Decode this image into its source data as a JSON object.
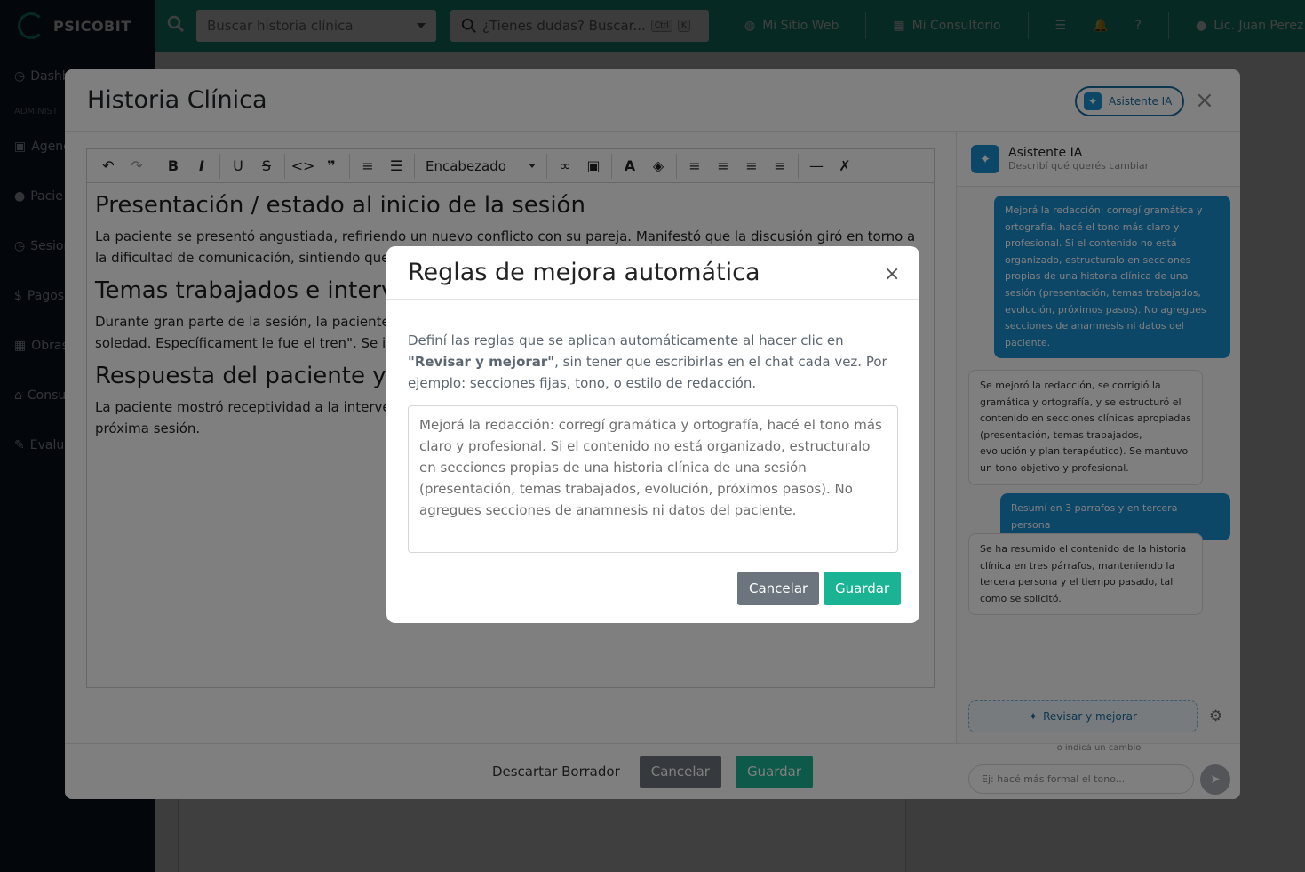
{
  "app": {
    "brand": "PSICOBIT",
    "search_placeholder": "Buscar historia clínica",
    "help_placeholder": "¿Tienes dudas? Buscar...",
    "kbd_ctrl": "Ctrl",
    "kbd_k": "K",
    "top_links": [
      "Mi Sitio Web",
      "Mi Consultorio"
    ],
    "user": "Lic. Juan Perez",
    "sidebar": {
      "dashboard": "Dashb",
      "section": "ADMINIST",
      "items": [
        "Agend",
        "Pacie",
        "Sesion",
        "Pagos",
        "Obras",
        "Consu",
        "Evalua"
      ]
    }
  },
  "modal": {
    "title": "Historia Clínica",
    "ai_button": "Asistente IA",
    "toolbar": {
      "heading": "Encabezado"
    },
    "document": {
      "sections": [
        {
          "heading": "Presentación / estado al inicio de la sesión",
          "text": "La paciente se presentó angustiada, refiriendo un nuevo conflicto con su pareja. Manifestó que la discusión giró en torno a la dificultad de comunicación, sintiendo que su p"
        },
        {
          "heading": "Temas trabajados e interve",
          "text": "Durante gran parte de la sesión, la paciente llo sentido seguir\" en referencia a la relación de p asociados y la idea de soledad. Específicament le fue el tren\". Se intervino señalando la autoex"
        },
        {
          "heading": "Respuesta del paciente y e",
          "text": "La paciente mostró receptividad a la intervenci evidenció un momento de reflexión sobre sus p figura paterna en la próxima sesión."
        }
      ]
    },
    "assistant": {
      "title": "Asistente IA",
      "subtitle": "Describí qué querés cambiar",
      "messages": [
        {
          "role": "user",
          "text": "Mejorá la redacción: corregí gramática y ortografía, hacé el tono más claro y profesional. Si el contenido no está organizado, estructuralo en secciones propias de una historia clínica de una sesión (presentación, temas trabajados, evolución, próximos pasos). No agregues secciones de anamnesis ni datos del paciente."
        },
        {
          "role": "bot",
          "text": "Se mejoró la redacción, se corrigió la gramática y ortografía, y se estructuró el contenido en secciones clínicas apropiadas (presentación, temas trabajados, evolución y plan terapéutico). Se mantuvo un tono objetivo y profesional."
        },
        {
          "role": "user",
          "text": "Resumí en 3 parrafos y en tercera persona"
        },
        {
          "role": "bot",
          "text": "Se ha resumido el contenido de la historia clínica en tres párrafos, manteniendo la tercera persona y el tiempo pasado, tal como se solicitó."
        }
      ],
      "revisar_label": "Revisar y mejorar",
      "or_label": "o indicá un cambio",
      "input_placeholder": "Ej: hacé más formal el tono..."
    },
    "footer": {
      "discard": "Descartar Borrador",
      "cancel": "Cancelar",
      "save": "Guardar"
    }
  },
  "rules_modal": {
    "title": "Reglas de mejora automática",
    "desc_prefix": "Definí las reglas que se aplican automáticamente al hacer clic en ",
    "desc_bold": "\"Revisar y mejorar\"",
    "desc_suffix": ", sin tener que escribirlas en el chat cada vez. Por ejemplo: secciones fijas, tono, o estilo de redacción.",
    "rules_text": "Mejorá la redacción: corregí gramática y ortografía, hacé el tono más claro y profesional. Si el contenido no está organizado, estructuralo en secciones propias de una historia clínica de una sesión (presentación, temas trabajados, evolución, próximos pasos). No agregues secciones de anamnesis ni datos del paciente.",
    "cancel": "Cancelar",
    "save": "Guardar"
  },
  "colors": {
    "brand_green": "#1aa88c",
    "sidebar_navy": "#0e1a2c",
    "ai_blue": "#1a8fd0",
    "save_green": "#1ab394",
    "cancel_gray": "#6c757d"
  }
}
